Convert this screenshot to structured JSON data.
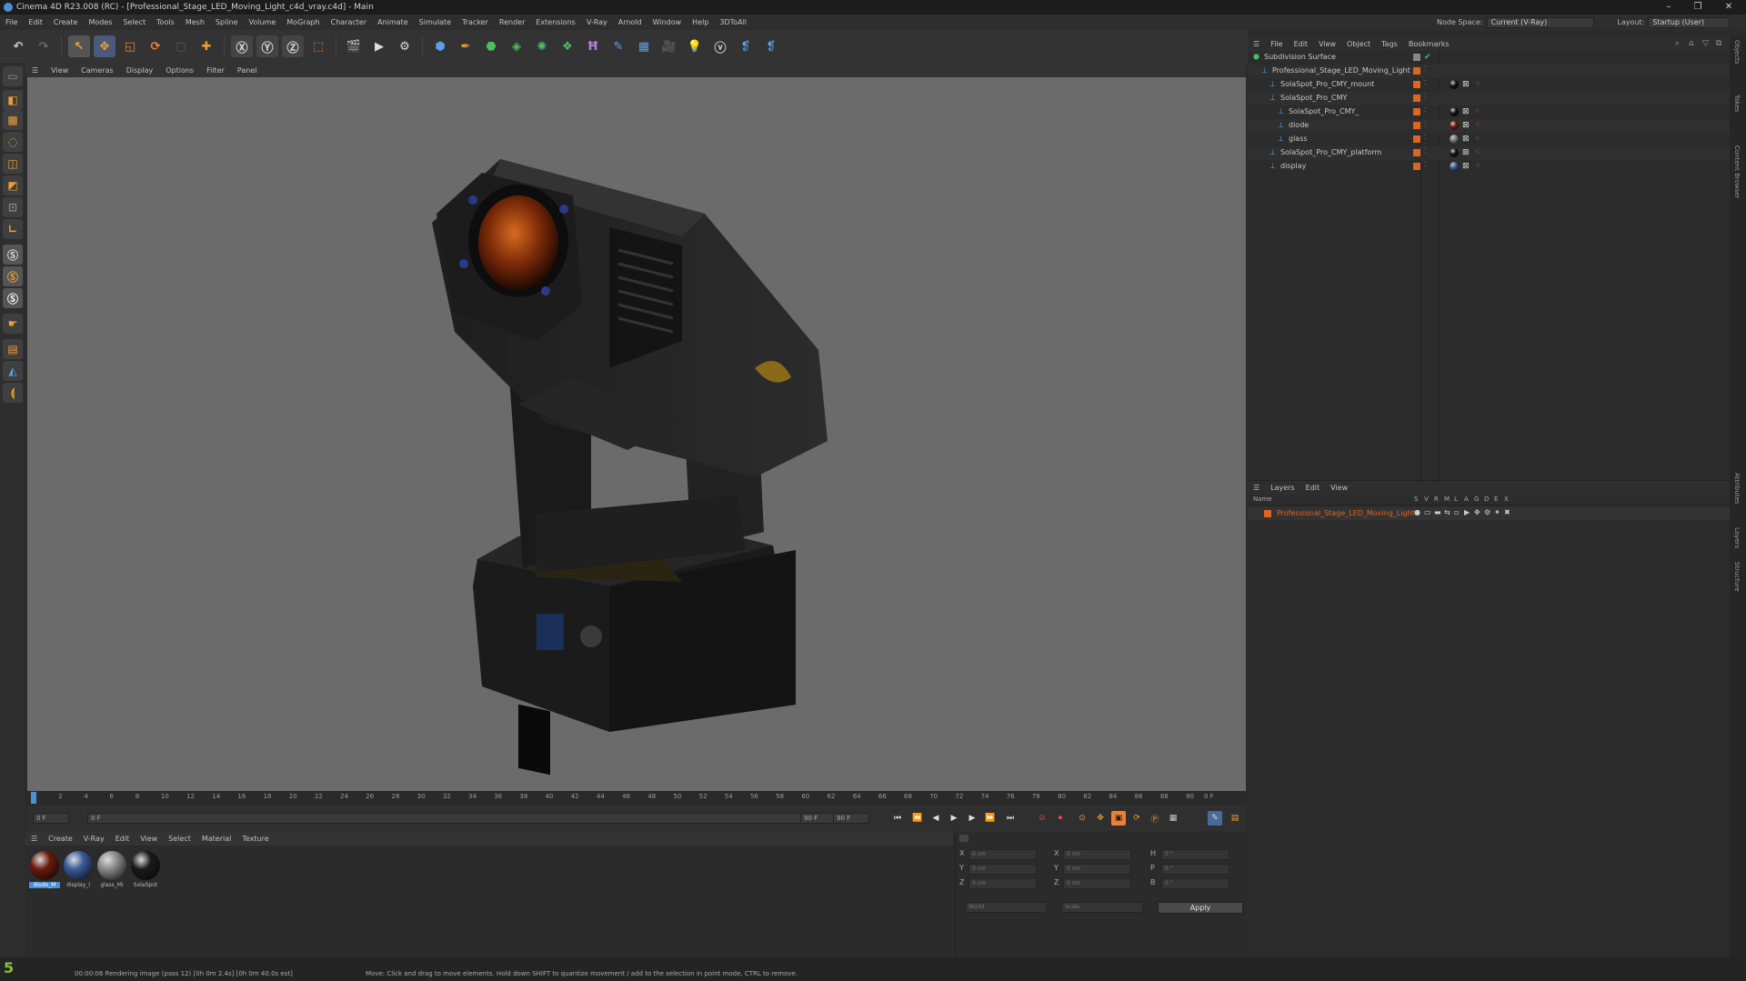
{
  "window": {
    "title": "Cinema 4D R23.008 (RC) - [Professional_Stage_LED_Moving_Light_c4d_vray.c4d] - Main"
  },
  "menu": [
    "File",
    "Edit",
    "Create",
    "Modes",
    "Select",
    "Tools",
    "Mesh",
    "Spline",
    "Volume",
    "MoGraph",
    "Character",
    "Animate",
    "Simulate",
    "Tracker",
    "Render",
    "Extensions",
    "V-Ray",
    "Arnold",
    "Window",
    "Help",
    "3DToAll"
  ],
  "node_space": {
    "label": "Node Space:",
    "value": "Current (V-Ray)"
  },
  "layout": {
    "label": "Layout:",
    "value": "Startup (User)"
  },
  "viewport_menu": [
    "View",
    "Cameras",
    "Display",
    "Options",
    "Filter",
    "Panel"
  ],
  "timeline": {
    "ticks": [
      "0",
      "2",
      "4",
      "6",
      "8",
      "10",
      "12",
      "14",
      "16",
      "18",
      "20",
      "22",
      "24",
      "26",
      "28",
      "30",
      "32",
      "34",
      "36",
      "38",
      "40",
      "42",
      "44",
      "46",
      "48",
      "50",
      "52",
      "54",
      "56",
      "58",
      "60",
      "62",
      "64",
      "66",
      "68",
      "70",
      "72",
      "74",
      "76",
      "78",
      "80",
      "82",
      "84",
      "86",
      "88",
      "90"
    ],
    "frame_end_label": "0 F",
    "current_frame": "0 F",
    "start_frame": "0 F",
    "end_frame": "90 F",
    "end_frame2": "90 F"
  },
  "material_menu": [
    "Create",
    "V-Ray",
    "Edit",
    "View",
    "Select",
    "Material",
    "Texture"
  ],
  "materials": [
    {
      "label": "diode_M",
      "color": "#6a1a0a"
    },
    {
      "label": "display_I",
      "color": "#3a5a9a"
    },
    {
      "label": "glass_Mi",
      "color": "#8a8a8a"
    },
    {
      "label": "SolaSpot",
      "color": "#1a1a1a"
    }
  ],
  "coords": {
    "rows": [
      {
        "a": "X",
        "av": "0 cm",
        "b": "X",
        "bv": "0 cm",
        "c": "H",
        "cv": "0 °"
      },
      {
        "a": "Y",
        "av": "0 cm",
        "b": "Y",
        "bv": "0 cm",
        "c": "P",
        "cv": "0 °"
      },
      {
        "a": "Z",
        "av": "0 cm",
        "b": "Z",
        "bv": "0 cm",
        "c": "B",
        "cv": "0 °"
      }
    ],
    "mode1": "World",
    "mode2": "Scale",
    "apply": "Apply"
  },
  "object_menu": [
    "File",
    "Edit",
    "View",
    "Object",
    "Tags",
    "Bookmarks"
  ],
  "objects": [
    {
      "name": "Subdivision Surface",
      "indent": 0,
      "tag": "",
      "green": true
    },
    {
      "name": "Professional_Stage_LED_Moving_Light",
      "indent": 1,
      "tag": ""
    },
    {
      "name": "SolaSpot_Pro_CMY_mount",
      "indent": 2,
      "tag": "#111111"
    },
    {
      "name": "SolaSpot_Pro_CMY",
      "indent": 2,
      "tag": ""
    },
    {
      "name": "SolaSpot_Pro_CMY_",
      "indent": 3,
      "tag": "#111111"
    },
    {
      "name": "diode",
      "indent": 3,
      "tag": "#6a1a0a"
    },
    {
      "name": "glass",
      "indent": 3,
      "tag": "#777777"
    },
    {
      "name": "SolaSpot_Pro_CMY_platform",
      "indent": 2,
      "tag": "#111111"
    },
    {
      "name": "display",
      "indent": 2,
      "tag": "#3a5a9a"
    }
  ],
  "layers_menu": [
    "Layers",
    "Edit",
    "View"
  ],
  "layers": {
    "header_name": "Name",
    "header_cols": [
      "S",
      "V",
      "R",
      "M",
      "L",
      "A",
      "G",
      "D",
      "E",
      "X"
    ],
    "items": [
      {
        "name": "Professional_Stage_LED_Moving_Light",
        "color": "#e0651e"
      }
    ]
  },
  "right_tabs": [
    "Objects",
    "Takes",
    "Content Browser",
    "Attributes",
    "Layers",
    "Structure"
  ],
  "status": {
    "left": "00:00:06 Rendering image (pass 12) [0h  0m  2.4s] [0h  0m 40.0s est]",
    "right": "Move: Click and drag to move elements. Hold down SHIFT to quantize movement / add to the selection in point mode, CTRL to remove."
  },
  "colors": {
    "accent": "#e0651e",
    "viewport_bg": "#6b6b6b",
    "select_blue": "#4a90d9"
  }
}
